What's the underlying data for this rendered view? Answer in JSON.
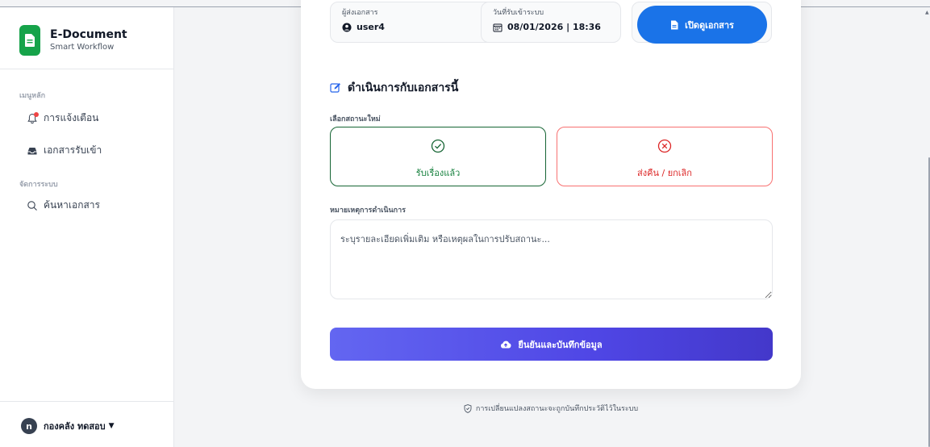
{
  "brand": {
    "title": "E-Document",
    "subtitle": "Smart Workflow"
  },
  "sidebar": {
    "main_section": "เมนูหลัก",
    "admin_section": "จัดการระบบ",
    "items": [
      {
        "label": "การแจ้งเตือน",
        "icon": "bell-icon"
      },
      {
        "label": "เอกสารรับเข้า",
        "icon": "inbox-icon"
      },
      {
        "label": "ค้นหาเอกสาร",
        "icon": "search-icon"
      }
    ],
    "user": {
      "initial": "n",
      "name": "กองคลัง ทดสอบ"
    }
  },
  "doc_info": {
    "sender_label": "ผู้ส่งเอกสาร",
    "sender_value": "user4",
    "received_label": "วันที่รับเข้าระบบ",
    "received_value": "08/01/2026 | 18:36",
    "open_button": "เปิดดูเอกสาร"
  },
  "action": {
    "title": "ดำเนินการกับเอกสารนี้",
    "status_label": "เลือกสถานะใหม่",
    "accept_label": "รับเรื่องแล้ว",
    "reject_label": "ส่งคืน / ยกเลิก",
    "note_label": "หมายเหตุการดำเนินการ",
    "note_placeholder": "ระบุรายละเอียดเพิ่มเติม หรือเหตุผลในการปรับสถานะ...",
    "submit_label": "ยืนยันและบันทึกข้อมูล",
    "footnote": "การเปลี่ยนแปลงสถานะจะถูกบันทึกประวัติไว้ในระบบ"
  },
  "colors": {
    "brand_green": "#16a34a",
    "primary_blue": "#1a73e8",
    "accept_green": "#15803d",
    "reject_red": "#dc2626",
    "submit_indigo": "#4f46e5"
  }
}
